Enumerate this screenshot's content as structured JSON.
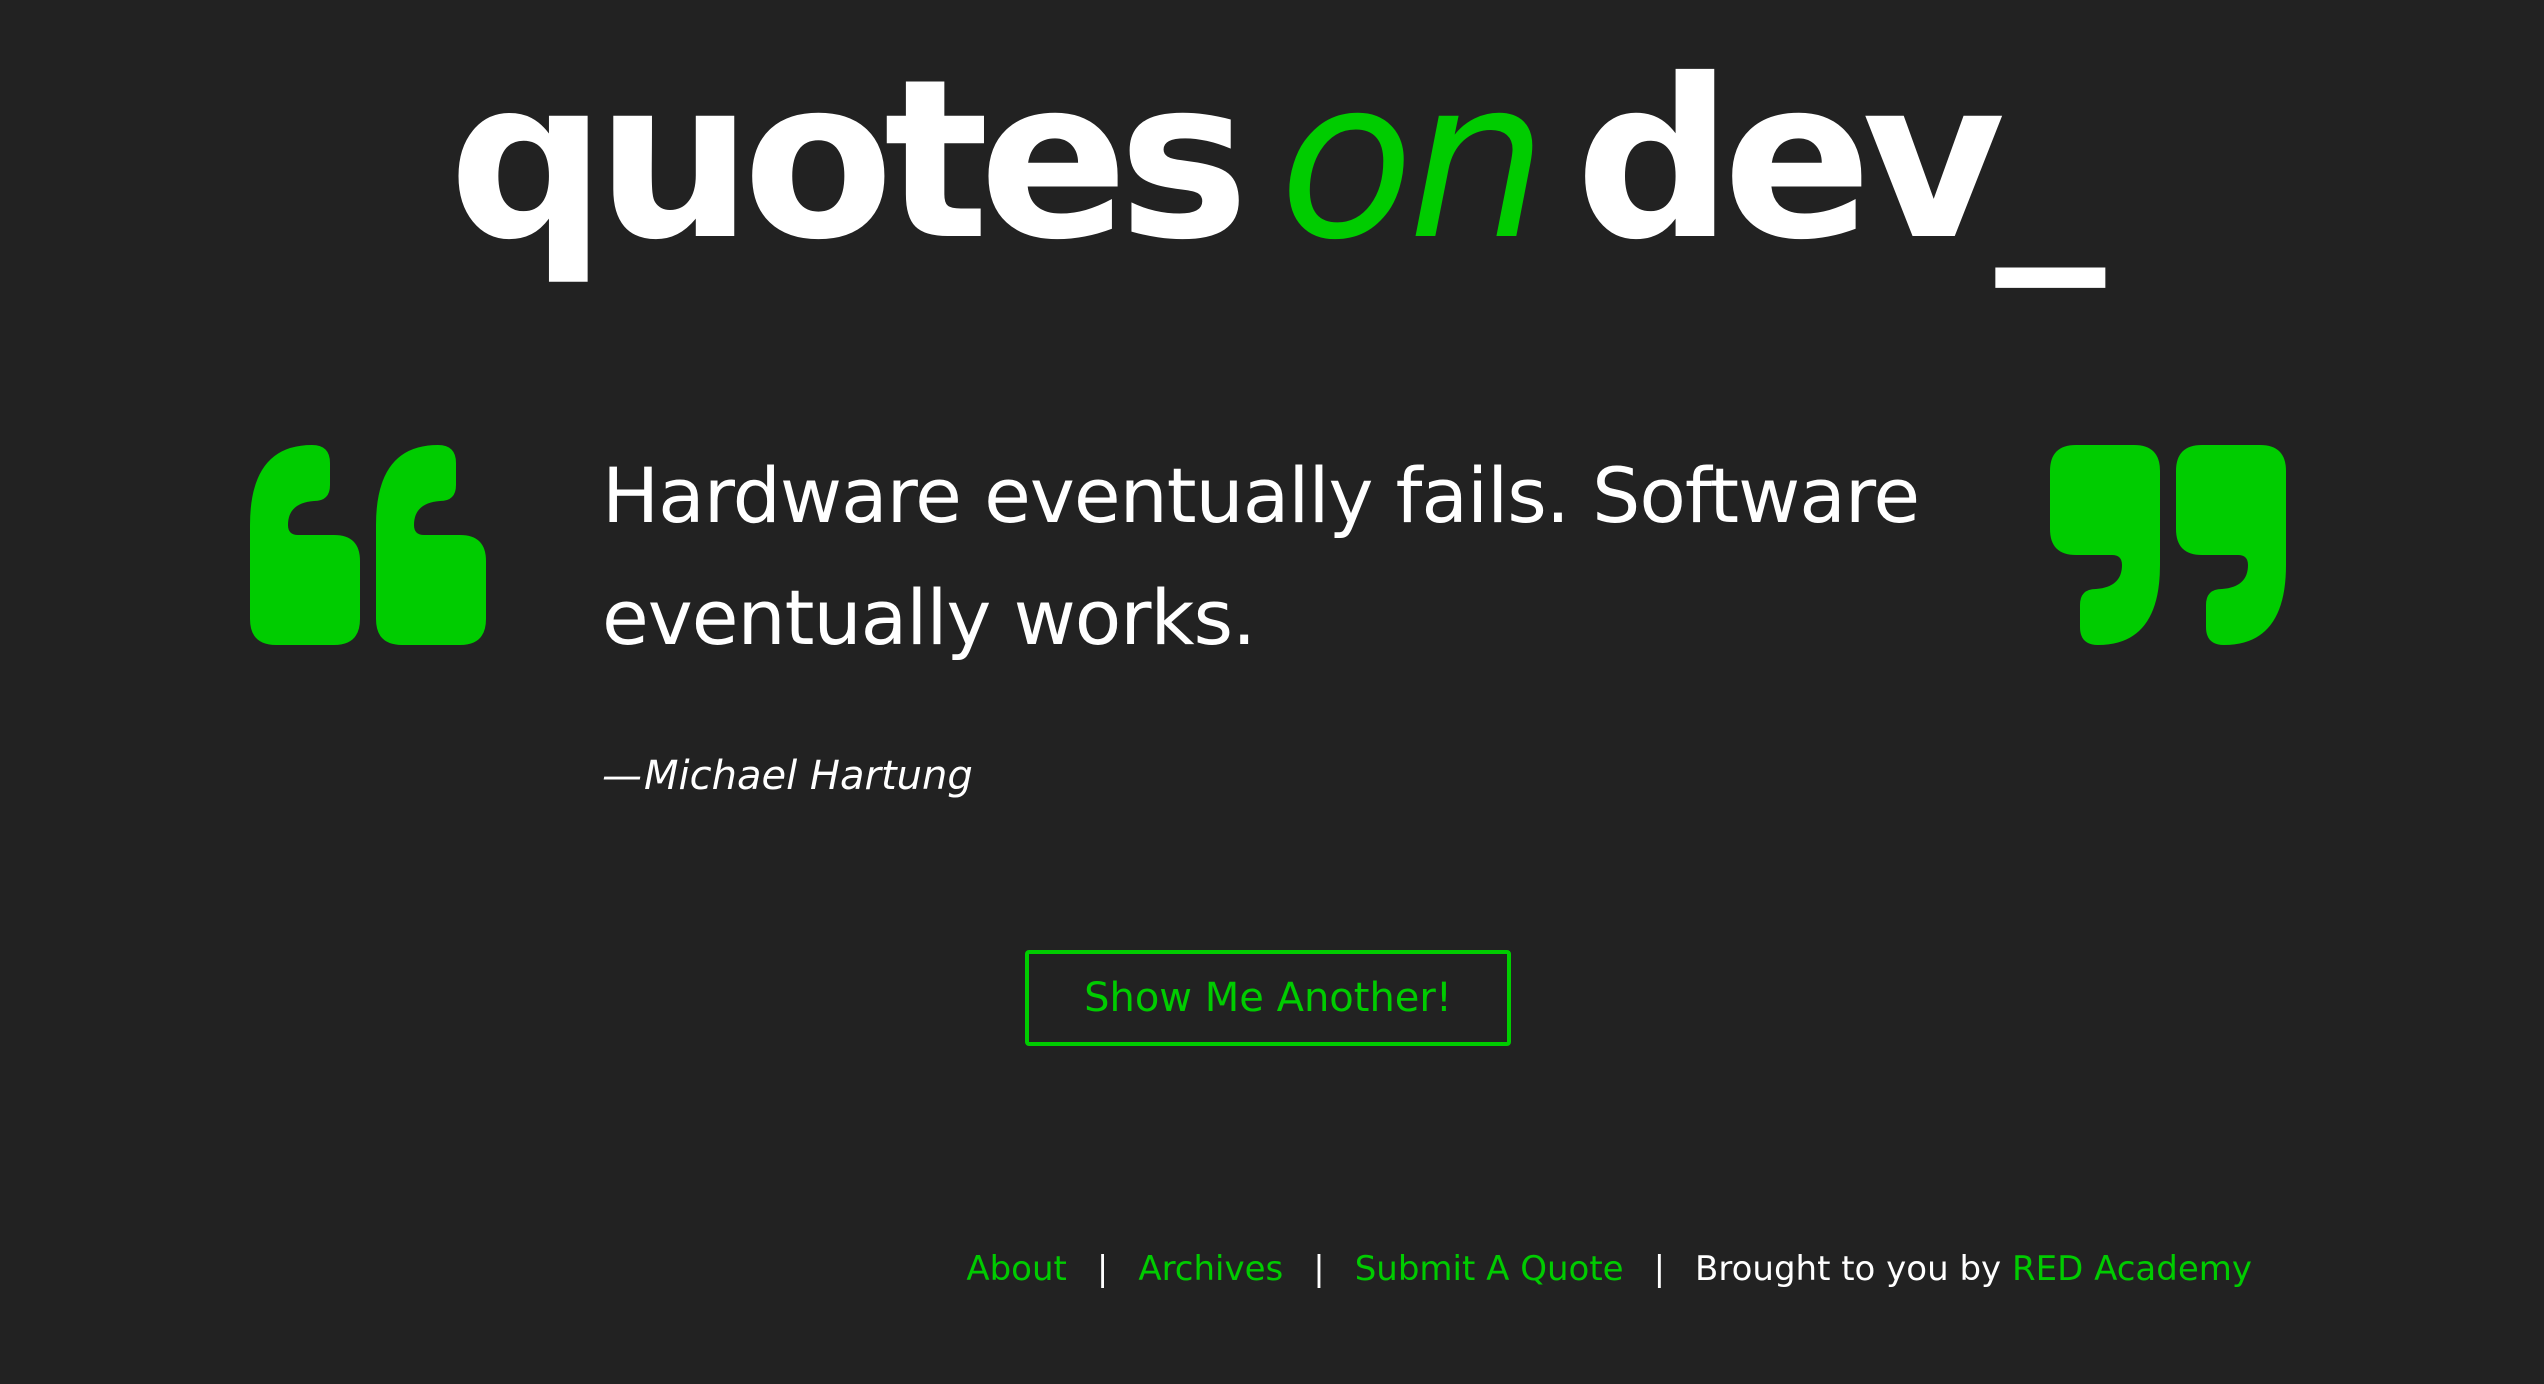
{
  "logo": {
    "word1": "quotes",
    "word2": "on",
    "word3": "dev_"
  },
  "quote": {
    "text": "Hardware eventually fails. Software eventually works.",
    "dash": "—",
    "author": "Michael Hartung"
  },
  "actions": {
    "another_label": "Show Me Another!"
  },
  "footer": {
    "links": [
      "About",
      "Archives",
      "Submit A Quote"
    ],
    "separator": "|",
    "credit_prefix": "Brought to you by",
    "credit_link": "RED Academy"
  },
  "icons": {
    "open_quote": "open-quote-icon",
    "close_quote": "close-quote-icon"
  },
  "colors": {
    "background": "#222222",
    "accent": "#00cc00",
    "text": "#ffffff"
  }
}
